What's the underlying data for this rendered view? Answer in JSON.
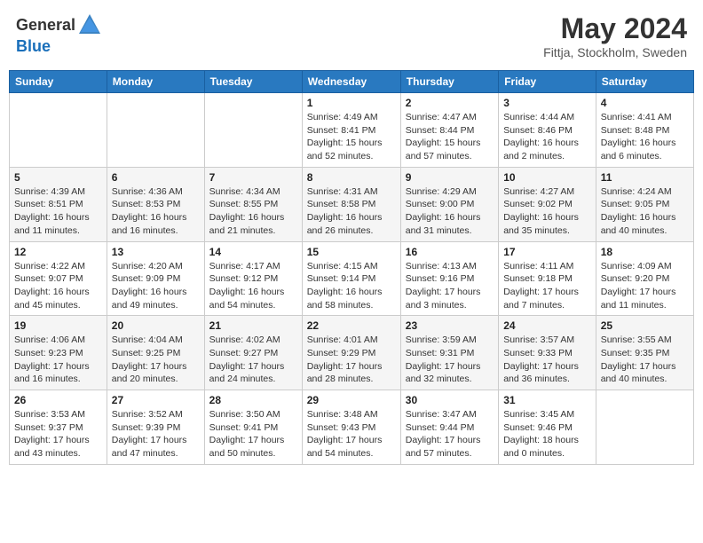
{
  "header": {
    "logo_general": "General",
    "logo_blue": "Blue",
    "title": "May 2024",
    "location": "Fittja, Stockholm, Sweden"
  },
  "days_of_week": [
    "Sunday",
    "Monday",
    "Tuesday",
    "Wednesday",
    "Thursday",
    "Friday",
    "Saturday"
  ],
  "weeks": [
    [
      {
        "day": "",
        "info": ""
      },
      {
        "day": "",
        "info": ""
      },
      {
        "day": "",
        "info": ""
      },
      {
        "day": "1",
        "info": "Sunrise: 4:49 AM\nSunset: 8:41 PM\nDaylight: 15 hours and 52 minutes."
      },
      {
        "day": "2",
        "info": "Sunrise: 4:47 AM\nSunset: 8:44 PM\nDaylight: 15 hours and 57 minutes."
      },
      {
        "day": "3",
        "info": "Sunrise: 4:44 AM\nSunset: 8:46 PM\nDaylight: 16 hours and 2 minutes."
      },
      {
        "day": "4",
        "info": "Sunrise: 4:41 AM\nSunset: 8:48 PM\nDaylight: 16 hours and 6 minutes."
      }
    ],
    [
      {
        "day": "5",
        "info": "Sunrise: 4:39 AM\nSunset: 8:51 PM\nDaylight: 16 hours and 11 minutes."
      },
      {
        "day": "6",
        "info": "Sunrise: 4:36 AM\nSunset: 8:53 PM\nDaylight: 16 hours and 16 minutes."
      },
      {
        "day": "7",
        "info": "Sunrise: 4:34 AM\nSunset: 8:55 PM\nDaylight: 16 hours and 21 minutes."
      },
      {
        "day": "8",
        "info": "Sunrise: 4:31 AM\nSunset: 8:58 PM\nDaylight: 16 hours and 26 minutes."
      },
      {
        "day": "9",
        "info": "Sunrise: 4:29 AM\nSunset: 9:00 PM\nDaylight: 16 hours and 31 minutes."
      },
      {
        "day": "10",
        "info": "Sunrise: 4:27 AM\nSunset: 9:02 PM\nDaylight: 16 hours and 35 minutes."
      },
      {
        "day": "11",
        "info": "Sunrise: 4:24 AM\nSunset: 9:05 PM\nDaylight: 16 hours and 40 minutes."
      }
    ],
    [
      {
        "day": "12",
        "info": "Sunrise: 4:22 AM\nSunset: 9:07 PM\nDaylight: 16 hours and 45 minutes."
      },
      {
        "day": "13",
        "info": "Sunrise: 4:20 AM\nSunset: 9:09 PM\nDaylight: 16 hours and 49 minutes."
      },
      {
        "day": "14",
        "info": "Sunrise: 4:17 AM\nSunset: 9:12 PM\nDaylight: 16 hours and 54 minutes."
      },
      {
        "day": "15",
        "info": "Sunrise: 4:15 AM\nSunset: 9:14 PM\nDaylight: 16 hours and 58 minutes."
      },
      {
        "day": "16",
        "info": "Sunrise: 4:13 AM\nSunset: 9:16 PM\nDaylight: 17 hours and 3 minutes."
      },
      {
        "day": "17",
        "info": "Sunrise: 4:11 AM\nSunset: 9:18 PM\nDaylight: 17 hours and 7 minutes."
      },
      {
        "day": "18",
        "info": "Sunrise: 4:09 AM\nSunset: 9:20 PM\nDaylight: 17 hours and 11 minutes."
      }
    ],
    [
      {
        "day": "19",
        "info": "Sunrise: 4:06 AM\nSunset: 9:23 PM\nDaylight: 17 hours and 16 minutes."
      },
      {
        "day": "20",
        "info": "Sunrise: 4:04 AM\nSunset: 9:25 PM\nDaylight: 17 hours and 20 minutes."
      },
      {
        "day": "21",
        "info": "Sunrise: 4:02 AM\nSunset: 9:27 PM\nDaylight: 17 hours and 24 minutes."
      },
      {
        "day": "22",
        "info": "Sunrise: 4:01 AM\nSunset: 9:29 PM\nDaylight: 17 hours and 28 minutes."
      },
      {
        "day": "23",
        "info": "Sunrise: 3:59 AM\nSunset: 9:31 PM\nDaylight: 17 hours and 32 minutes."
      },
      {
        "day": "24",
        "info": "Sunrise: 3:57 AM\nSunset: 9:33 PM\nDaylight: 17 hours and 36 minutes."
      },
      {
        "day": "25",
        "info": "Sunrise: 3:55 AM\nSunset: 9:35 PM\nDaylight: 17 hours and 40 minutes."
      }
    ],
    [
      {
        "day": "26",
        "info": "Sunrise: 3:53 AM\nSunset: 9:37 PM\nDaylight: 17 hours and 43 minutes."
      },
      {
        "day": "27",
        "info": "Sunrise: 3:52 AM\nSunset: 9:39 PM\nDaylight: 17 hours and 47 minutes."
      },
      {
        "day": "28",
        "info": "Sunrise: 3:50 AM\nSunset: 9:41 PM\nDaylight: 17 hours and 50 minutes."
      },
      {
        "day": "29",
        "info": "Sunrise: 3:48 AM\nSunset: 9:43 PM\nDaylight: 17 hours and 54 minutes."
      },
      {
        "day": "30",
        "info": "Sunrise: 3:47 AM\nSunset: 9:44 PM\nDaylight: 17 hours and 57 minutes."
      },
      {
        "day": "31",
        "info": "Sunrise: 3:45 AM\nSunset: 9:46 PM\nDaylight: 18 hours and 0 minutes."
      },
      {
        "day": "",
        "info": ""
      }
    ]
  ]
}
